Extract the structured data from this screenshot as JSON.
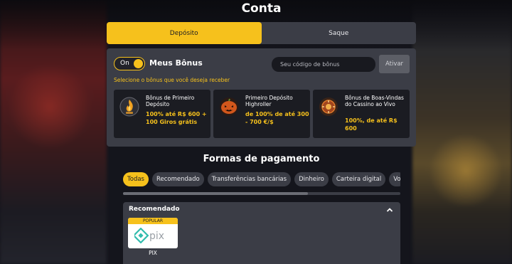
{
  "modal": {
    "title": "Conta"
  },
  "tabs": [
    {
      "label": "Depósito",
      "active": true
    },
    {
      "label": "Saque",
      "active": false
    }
  ],
  "bonus": {
    "toggle_label": "On",
    "toggle_on": true,
    "title": "Meus Bônus",
    "hint": "Selecione o bônus que você deseja receber",
    "code_placeholder": "Seu código de bônus",
    "activate_label": "Ativar",
    "cards": [
      {
        "name": "Bônus de Primeiro Depósito",
        "offer": "100% até R$ 600 + 100 Giros grátis",
        "icon": "flame-coin-icon"
      },
      {
        "name": "Primeiro Depósito Highroller",
        "offer": "de 100% de até 300 - 700 €/$",
        "icon": "pumpkin-icon"
      },
      {
        "name": "Bônus de Boas-Vindas do Cassino ao Vivo",
        "offer": "100%, de até R$ 600",
        "icon": "live-casino-icon"
      }
    ]
  },
  "payment": {
    "section_title": "Formas de pagamento",
    "filters": [
      {
        "label": "Todas",
        "active": true
      },
      {
        "label": "Recomendado",
        "active": false
      },
      {
        "label": "Transferências bancárias",
        "active": false
      },
      {
        "label": "Dinheiro",
        "active": false
      },
      {
        "label": "Carteira digital",
        "active": false
      },
      {
        "label": "Vo",
        "active": false
      }
    ],
    "recommended": {
      "title": "Recomendado",
      "methods": [
        {
          "badge": "POPULAR",
          "name": "PIX",
          "logo_text": "pix"
        }
      ]
    }
  },
  "colors": {
    "accent": "#f6c11c",
    "panel": "#3b3d46",
    "card": "#1b1c22",
    "pix_teal": "#32bcad"
  }
}
